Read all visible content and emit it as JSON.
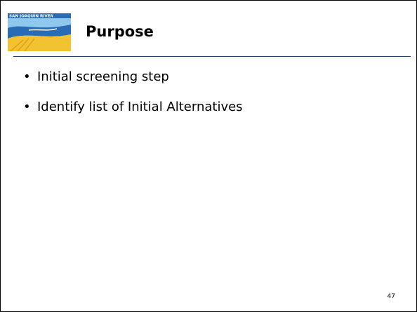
{
  "slide": {
    "logo_text": "SAN JOAQUIN RIVER",
    "title": "Purpose",
    "bullet_glyph": "•",
    "bullets": [
      {
        "text": "Initial screening step"
      },
      {
        "text": "Identify list of Initial Alternatives"
      }
    ],
    "page_number": "47"
  },
  "colors": {
    "title_rule": "#1f3f6a",
    "logo_blue": "#2a6bb5",
    "logo_yellow": "#f2c230",
    "logo_light_blue": "#8ec8ec"
  }
}
